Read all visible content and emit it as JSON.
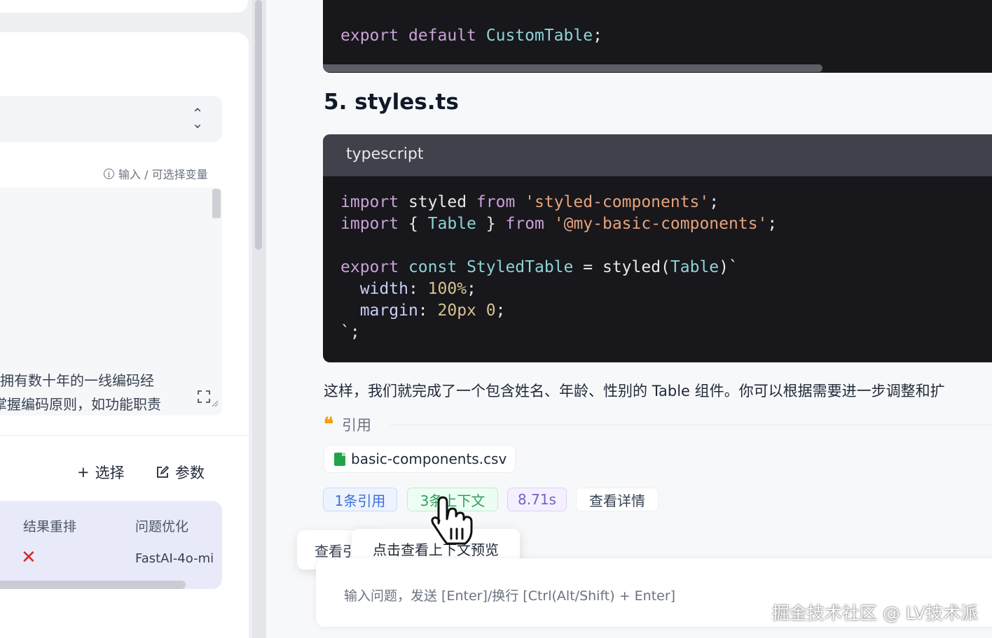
{
  "left_panel": {
    "input_hint": "输入 / 可选择变量",
    "prompt_lines": [
      "拥有数十年的一线编码经",
      "掌握编码原则，如功能职责"
    ],
    "select_button": "选择",
    "params_button": "参数",
    "config_table": {
      "headers": [
        "结果重排",
        "问题优化"
      ],
      "row": {
        "rerank": "✕",
        "optimize_model": "FastAI-4o-mi"
      }
    }
  },
  "chat": {
    "code_top_line": {
      "kw": "export",
      "kw2": "default",
      "name": "CustomTable",
      "end": ";"
    },
    "section_heading": "5. styles.ts",
    "code_block": {
      "language": "typescript",
      "tokens": {
        "import": "import",
        "styled": "styled",
        "from": "from",
        "str1": "'styled-components'",
        "brace_open": "{",
        "table": "Table",
        "brace_close": "}",
        "str2": "'@my-basic-components'",
        "semi": ";",
        "export": "export",
        "const": "const",
        "styled_table": "StyledTable",
        "eq": "=",
        "styled_call": "styled(",
        "close_tick": ")`",
        "width_prop": "width",
        "width_val": "100%",
        "margin_prop": "margin",
        "margin_val": "20px 0",
        "end_tick": "`;"
      }
    },
    "answer_text": "这样，我们就完成了一个包含姓名、年龄、性别的 Table 组件。你可以根据需要进一步调整和扩",
    "quote_label": "引用",
    "file_name": "basic-components.csv",
    "tags": {
      "cite": "1条引用",
      "context": "3条上下文",
      "time": "8.71s",
      "detail": "查看详情"
    },
    "tooltip_back": "查看引",
    "tooltip": "点击查看上下文预览",
    "input_placeholder": "输入问题，发送 [Enter]/换行 [Ctrl(Alt/Shift) + Enter]"
  },
  "watermark": "掘金技术社区 @ LV技术派",
  "colors": {
    "code_bg": "#17171c",
    "accent_blue": "#3b6fd8",
    "accent_green": "#2f9e5f",
    "accent_purple": "#7b5cc4",
    "error_red": "#dc2626"
  }
}
